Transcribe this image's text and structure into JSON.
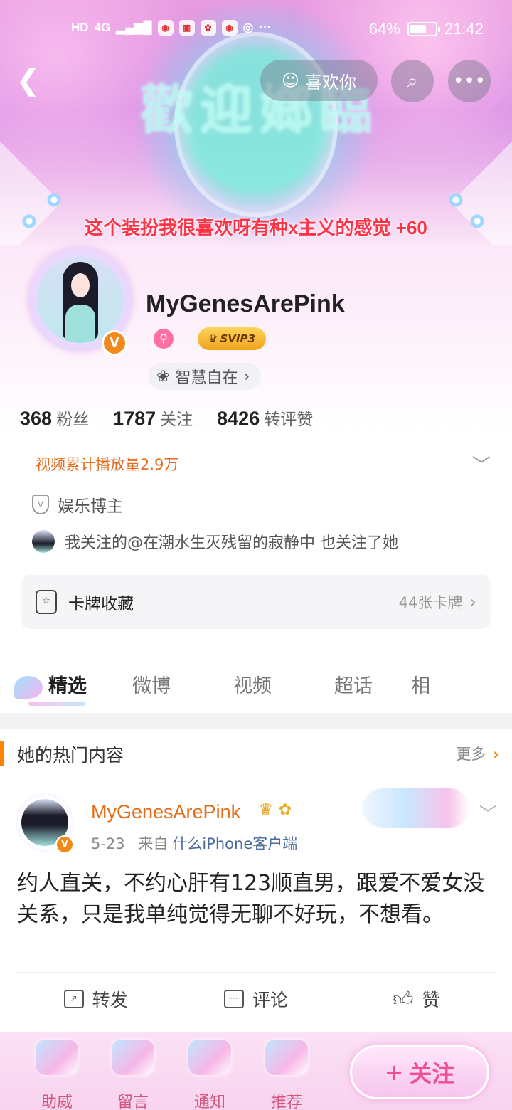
{
  "status_bar": {
    "left_icons": [
      "HD",
      "4G",
      "signal-icon",
      "weibo-icon",
      "tv-icon",
      "huawei-icon",
      "weibo-icon",
      "location-icon",
      "more-dots-icon"
    ],
    "hd_label": "HD",
    "network_label": "4G",
    "battery": "64%",
    "battery_level": 0.64,
    "time": "21:42"
  },
  "header": {
    "like_label": "喜欢你",
    "banner_welcome": "歡迎嫏臨",
    "banner_tagline": "这个装扮我很喜欢呀有种x主义的感觉 +60"
  },
  "profile": {
    "username": "MyGenesArePink",
    "verified_badge": "V",
    "gender_icon": "female-icon",
    "svip_label": "SVIP3",
    "wisdom_label": "智慧自在",
    "stats": [
      {
        "value": "368",
        "label": "粉丝"
      },
      {
        "value": "1787",
        "label": "关注"
      },
      {
        "value": "8426",
        "label": "转评赞"
      }
    ],
    "video_plays": "视频累计播放量2.9万",
    "category": "娱乐博主",
    "mutual_follow": "我关注的@在潮水生灭残留的寂静中 也关注了她",
    "cards_label": "卡牌收藏",
    "cards_count": "44张卡牌"
  },
  "tabs": [
    {
      "label": "精选",
      "active": true
    },
    {
      "label": "微博",
      "active": false
    },
    {
      "label": "视频",
      "active": false
    },
    {
      "label": "超话",
      "active": false
    },
    {
      "label": "相",
      "active": false
    }
  ],
  "hot": {
    "title": "她的热门内容",
    "more_label": "更多"
  },
  "post": {
    "author": "MyGenesArePink",
    "date": "5-23",
    "source_prefix": "来自",
    "source": "什么iPhone客户端",
    "text": "约人直关，不约心肝有123顺直男，跟爱不爱女没关系，只是我单纯觉得无聊不好玩，不想看。",
    "actions": [
      {
        "label": "转发",
        "icon": "repost-icon"
      },
      {
        "label": "评论",
        "icon": "comment-icon"
      },
      {
        "label": "赞",
        "icon": "thumbs-up-icon"
      }
    ]
  },
  "bottom_bar": {
    "items": [
      {
        "label": "助威"
      },
      {
        "label": "留言"
      },
      {
        "label": "通知"
      },
      {
        "label": "推荐"
      }
    ],
    "follow_label": "关注"
  }
}
